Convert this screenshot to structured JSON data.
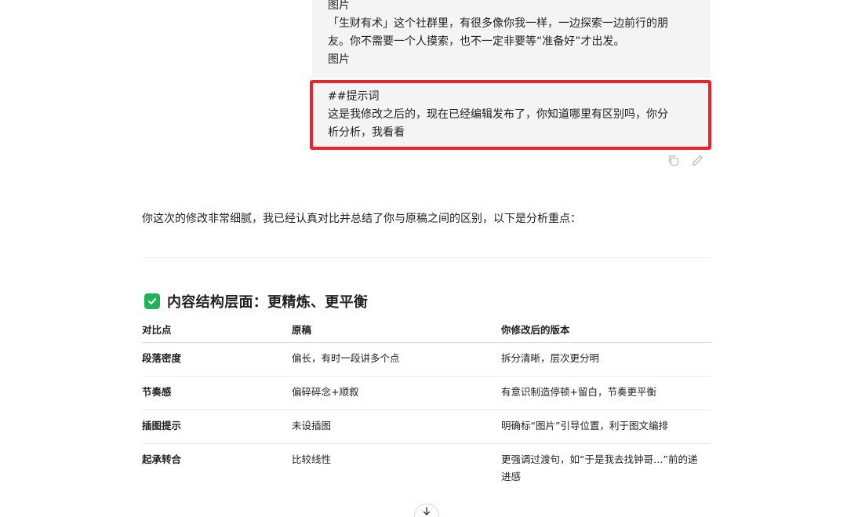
{
  "user_message": {
    "lines": [
      "图片",
      "「生财有术」这个社群里，有很多像你我一样，一边探索一边前行的朋",
      "友。你不需要一个人摸索，也不一定非要等“准备好”才出发。",
      "图片"
    ]
  },
  "highlighted_prompt": {
    "lines": [
      "##提示词",
      "这是我修改之后的，现在已经编辑发布了，你知道哪里有区别吗，你分",
      "析分析，我看看"
    ],
    "border_color": "#e8232b"
  },
  "message_actions": {
    "copy_icon": "copy-icon",
    "edit_icon": "pencil-icon"
  },
  "assistant_reply": {
    "intro": "你这次的修改非常细腻，我已经认真对比并总结了你与原稿之间的区别，以下是分析重点：",
    "section": {
      "icon": "green-check-icon",
      "icon_color": "#22b35a",
      "title": "内容结构层面：更精炼、更平衡"
    },
    "table": {
      "headers": [
        "对比点",
        "原稿",
        "你修改后的版本"
      ],
      "rows": [
        [
          "段落密度",
          "偏长，有时一段讲多个点",
          "拆分清晰，层次更分明"
        ],
        [
          "节奏感",
          "偏碎碎念+顺叙",
          "有意识制造停顿+留白，节奏更平衡"
        ],
        [
          "插图提示",
          "未设插图",
          "明确标“图片”引导位置，利于图文编排"
        ],
        [
          "起承转合",
          "比较线性",
          "更强调过渡句，如“于是我去找钟哥…”前的递",
          "进感"
        ]
      ]
    }
  },
  "scroll_button": {
    "icon": "arrow-down-icon"
  }
}
